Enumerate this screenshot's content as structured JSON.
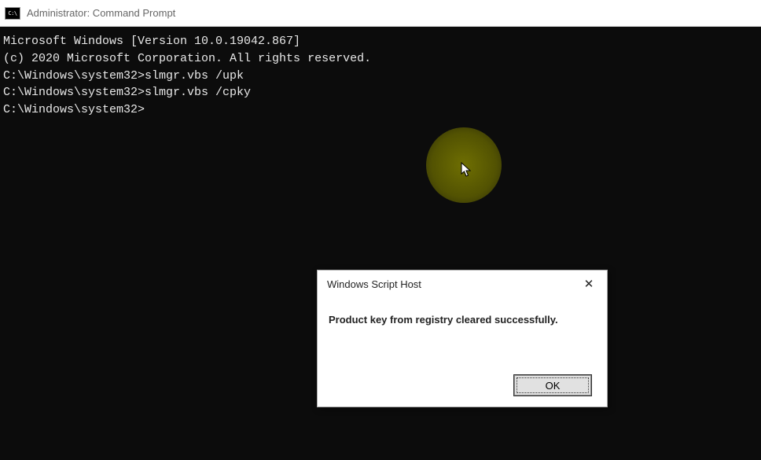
{
  "window": {
    "title": "Administrator: Command Prompt"
  },
  "terminal": {
    "line1": "Microsoft Windows [Version 10.0.19042.867]",
    "line2": "(c) 2020 Microsoft Corporation. All rights reserved.",
    "blank1": "",
    "line3": "C:\\Windows\\system32>slmgr.vbs /upk",
    "blank2": "",
    "line4": "C:\\Windows\\system32>slmgr.vbs /cpky",
    "blank3": "",
    "line5": "C:\\Windows\\system32>"
  },
  "dialog": {
    "title": "Windows Script Host",
    "message": "Product key from registry cleared successfully.",
    "ok_label": "OK",
    "close_label": "✕"
  }
}
